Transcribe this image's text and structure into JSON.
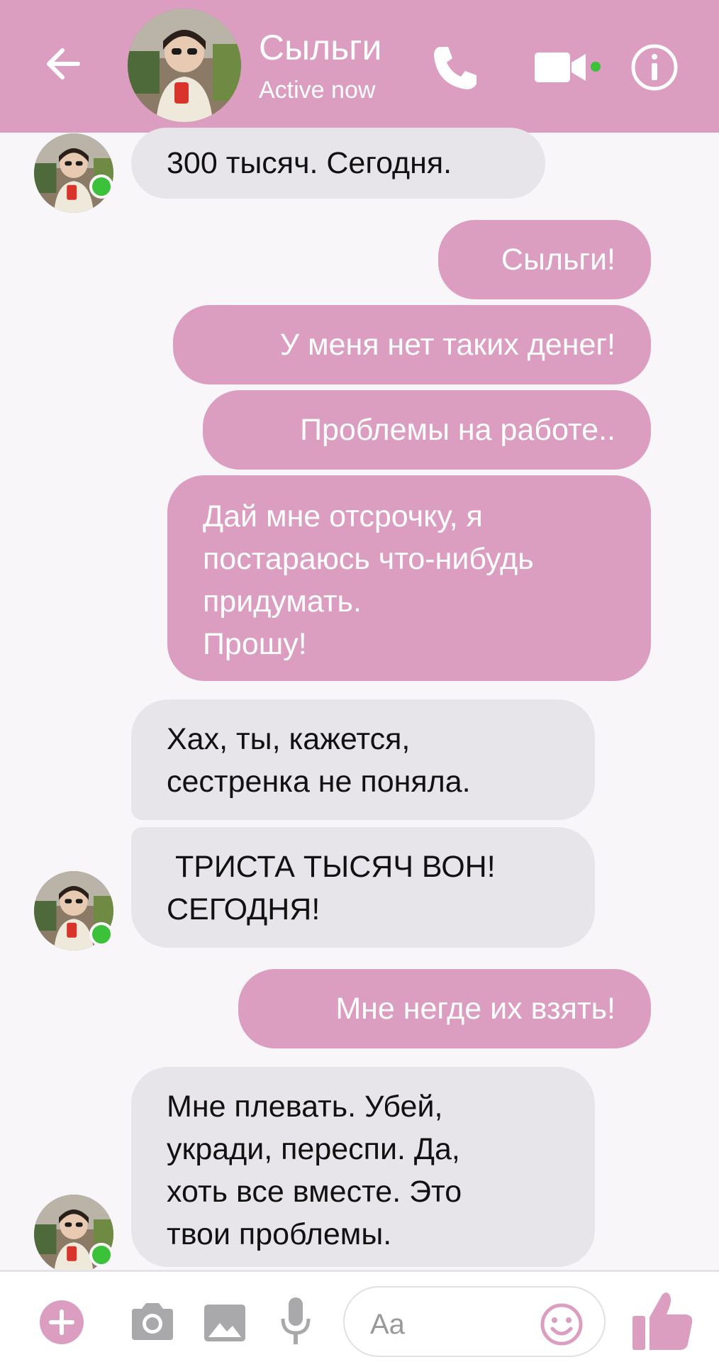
{
  "header": {
    "contact_name": "Сыльги",
    "status": "Active now",
    "accent_color": "#dc9ec0",
    "online_color": "#3cc13b"
  },
  "icons": {
    "back": "arrow-left-icon",
    "call": "phone-icon",
    "video": "video-camera-icon",
    "info": "info-icon",
    "plus": "plus-icon",
    "camera": "camera-icon",
    "gallery": "image-icon",
    "mic": "microphone-icon",
    "emoji": "smiley-icon",
    "like": "thumbs-up-icon"
  },
  "messages": [
    {
      "direction": "incoming",
      "lines": [
        "300 тысяч. Сегодня."
      ]
    },
    {
      "direction": "outgoing",
      "lines": [
        "Сыльги!"
      ]
    },
    {
      "direction": "outgoing",
      "lines": [
        "У меня нет таких денег!"
      ]
    },
    {
      "direction": "outgoing",
      "lines": [
        "Проблемы на работе.."
      ]
    },
    {
      "direction": "outgoing",
      "lines": [
        "Дай мне отсрочку, я",
        "постараюсь что-нибудь",
        "придумать.",
        "Прошу!"
      ]
    },
    {
      "direction": "incoming",
      "lines": [
        "Хах, ты, кажется,",
        "сестренка не поняла."
      ]
    },
    {
      "direction": "incoming",
      "lines": [
        " ТРИСТА ТЫСЯЧ ВОН!",
        "СЕГОДНЯ!"
      ]
    },
    {
      "direction": "outgoing",
      "lines": [
        "Мне негде их взять!"
      ]
    },
    {
      "direction": "incoming",
      "lines": [
        "Мне плевать. Убей,",
        "укради, переспи. Да,",
        "хоть все вместе. Это",
        "твои проблемы."
      ]
    }
  ],
  "composer": {
    "placeholder": "Aa"
  }
}
